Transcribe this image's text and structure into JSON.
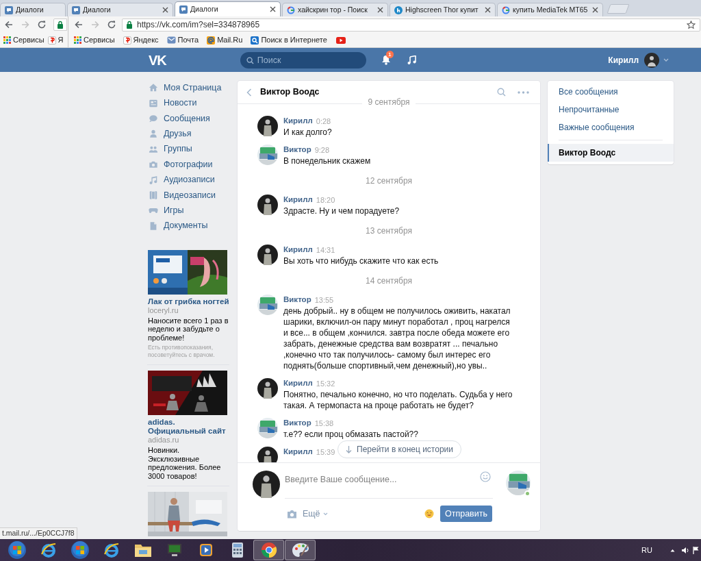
{
  "browser": {
    "tabs": [
      {
        "title": "Диалоги",
        "kind": "vk",
        "selected": false
      },
      {
        "title": "Диалоги",
        "kind": "vk",
        "selected": false
      },
      {
        "title": "Диалоги",
        "kind": "vk",
        "selected": true
      },
      {
        "title": "хайскрин тор - Поиск",
        "kind": "google",
        "selected": false
      },
      {
        "title": "Highscreen Thor купит",
        "kind": "h",
        "selected": false
      },
      {
        "title": "купить MediaTek MT65",
        "kind": "google",
        "selected": false
      }
    ],
    "background_window": {
      "bookmarks": [
        {
          "kind": "apps",
          "label": "Сервисы"
        },
        {
          "kind": "yandex",
          "label": "Я"
        }
      ]
    },
    "url": "https://vk.com/im?sel=334878965",
    "bookmarks": [
      {
        "kind": "apps",
        "label": "Сервисы"
      },
      {
        "kind": "yandex",
        "label": "Яндекс"
      },
      {
        "kind": "mail",
        "label": "Почта"
      },
      {
        "kind": "at",
        "label": "Mail.Ru"
      },
      {
        "kind": "search",
        "label": "Поиск в Интернете"
      },
      {
        "kind": "youtube"
      }
    ]
  },
  "vk_header": {
    "logo": "VK",
    "search_placeholder": "Поиск",
    "notification_count": "1",
    "user_name": "Кирилл"
  },
  "nav": [
    {
      "kind": "home",
      "label": "Моя Страница"
    },
    {
      "kind": "news",
      "label": "Новости"
    },
    {
      "kind": "messages",
      "label": "Сообщения"
    },
    {
      "kind": "friends",
      "label": "Друзья"
    },
    {
      "kind": "groups",
      "label": "Группы"
    },
    {
      "kind": "photos",
      "label": "Фотографии"
    },
    {
      "kind": "audio",
      "label": "Аудиозаписи"
    },
    {
      "kind": "video",
      "label": "Видеозаписи"
    },
    {
      "kind": "games",
      "label": "Игры"
    },
    {
      "kind": "docs",
      "label": "Документы"
    }
  ],
  "ads": [
    {
      "kind": "picture",
      "title": "Лак от грибка ногтей",
      "domain": "loceryl.ru",
      "text": "Наносите всего 1 раз в неделю и забудьте о проблеме!",
      "note": "Есть противопоказания, посоветуйтесь с врачом."
    },
    {
      "kind": "picture",
      "title": "adidas. Официальный сайт",
      "domain": "adidas.ru",
      "text": "Новинки. Эксклюзивные предложения. Более 3000 товаров!"
    },
    {
      "kind": "picture"
    }
  ],
  "chat": {
    "peer_name": "Виктор Воодс",
    "timeline": [
      {
        "kind": "date",
        "text": "9 сентября"
      },
      {
        "kind": "outgoing",
        "author": "Кирилл",
        "time": "0:28",
        "text": "И как долго?"
      },
      {
        "kind": "incoming",
        "author": "Виктор",
        "time": "9:28",
        "text": "В понедельник скажем"
      },
      {
        "kind": "date",
        "text": "12 сентября"
      },
      {
        "kind": "outgoing",
        "author": "Кирилл",
        "time": "18:20",
        "text": "Здрасте. Ну и чем порадуете?"
      },
      {
        "kind": "date",
        "text": "13 сентября"
      },
      {
        "kind": "outgoing",
        "author": "Кирилл",
        "time": "14:31",
        "text": "Вы хоть что нибудь скажите что как есть"
      },
      {
        "kind": "date",
        "text": "14 сентября"
      },
      {
        "kind": "incoming",
        "author": "Виктор",
        "time": "13:55",
        "text": "день добрый.. ну в общем не получилось оживить, накатал шарики, включил-он пару минут поработал , проц нагрелся и все... в общем ,кончился. завтра после обеда можете его забрать, денежные средства вам возвратят ... печально ,конечно что так получилось- самому был интерес его поднять(больше спортивный,чем денежный),но увы.."
      },
      {
        "kind": "outgoing",
        "author": "Кирилл",
        "time": "15:32",
        "text": "Понятно, печально конечно, но что поделать. Судьба у него такая. А термопаста на проце работать не будет?"
      },
      {
        "kind": "incoming",
        "author": "Виктор",
        "time": "15:38",
        "text": "т.е?? если проц обмазать пастой??"
      },
      {
        "kind": "outgoing",
        "author": "Кирилл",
        "time": "15:39"
      }
    ],
    "jump_button": "Перейти в конец истории",
    "composer": {
      "placeholder": "Введите Ваше сообщение...",
      "more": "Ещё",
      "send": "Отправить"
    }
  },
  "right_menu": [
    {
      "kind": "filter",
      "label": "Все сообщения",
      "selected": false
    },
    {
      "kind": "filter",
      "label": "Непрочитанные",
      "selected": false
    },
    {
      "kind": "filter",
      "label": "Важные сообщения",
      "selected": false
    },
    {
      "kind": "dialog",
      "label": "Виктор Воодс",
      "selected": true
    }
  ],
  "status_url": "t.mail.ru/.../Ep0CCJ7f8",
  "taskbar": {
    "apps": [
      {
        "kind": "start",
        "active": false
      },
      {
        "kind": "ie",
        "active": false
      },
      {
        "kind": "start",
        "active": false
      },
      {
        "kind": "ie",
        "active": false
      },
      {
        "kind": "folder",
        "active": false
      },
      {
        "kind": "monitor",
        "active": false
      },
      {
        "kind": "media",
        "active": false
      },
      {
        "kind": "calculator",
        "active": false
      },
      {
        "kind": "chrome",
        "active": true
      },
      {
        "kind": "paint",
        "active": true
      }
    ],
    "language": "RU"
  }
}
